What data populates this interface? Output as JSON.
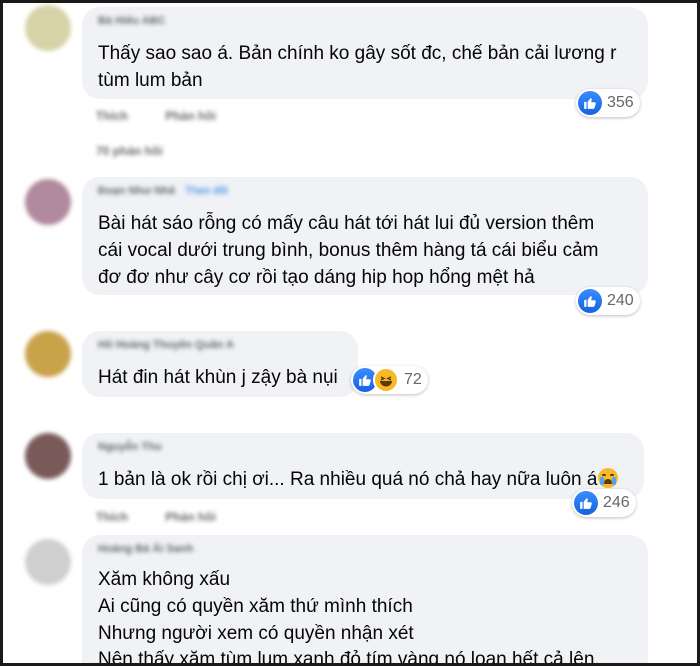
{
  "comments": [
    {
      "author": "Bà Hiếu ABC",
      "follow": "",
      "lines": [
        "Thấy sao sao á. Bản chính ko gây sốt đc, chế bản cải lương r",
        "tùm lum bản"
      ],
      "reactions": [
        "like"
      ],
      "count": "356",
      "actions": [
        "Thích",
        "Phản hồi"
      ],
      "replies": "70 phản hồi",
      "avatar_color": "#d7d3a8"
    },
    {
      "author": "Đoạn Như Nhã",
      "follow": "Theo dõi",
      "lines": [
        "Bài hát sáo rỗng có mấy câu hát tới hát lui đủ version thêm",
        "cái vocal dưới trung bình, bonus thêm hàng tá cái biểu cảm",
        "đơ đơ như cây cơ rồi tạo dáng hip hop hổng mệt hả"
      ],
      "reactions": [
        "like"
      ],
      "count": "240",
      "actions": [],
      "replies": "",
      "avatar_color": "#b08a9e"
    },
    {
      "author": "Hồ Hoàng Thuyên Quân A",
      "follow": "",
      "lines": [
        "Hát đin hát khùn j zậy bà nụi"
      ],
      "reactions": [
        "like",
        "haha"
      ],
      "count": "72",
      "actions": [],
      "replies": "",
      "avatar_color": "#c9a24a"
    },
    {
      "author": "Nguyễn Thu",
      "follow": "",
      "lines": [
        "1 bản là ok rồi chị ơi... Ra nhiều quá nó chả hay nữa luôn á"
      ],
      "reactions": [
        "like"
      ],
      "count": "246",
      "actions": [
        "Thích",
        "Phản hồi"
      ],
      "replies": "",
      "avatar_color": "#7a5a58"
    },
    {
      "author": "Hoàng Bá Ái Sanh",
      "follow": "",
      "lines": [
        "Xăm không xấu",
        "Ai cũng có quyền xăm thứ mình thích",
        "Nhưng người xem có quyền nhận xét",
        "Nên thấy xăm tùm lum xanh đỏ tím vàng nó loạn hết cả lên."
      ],
      "reactions": [],
      "count": "",
      "actions": [],
      "replies": "",
      "avatar_color": "#cfcfcf"
    }
  ]
}
